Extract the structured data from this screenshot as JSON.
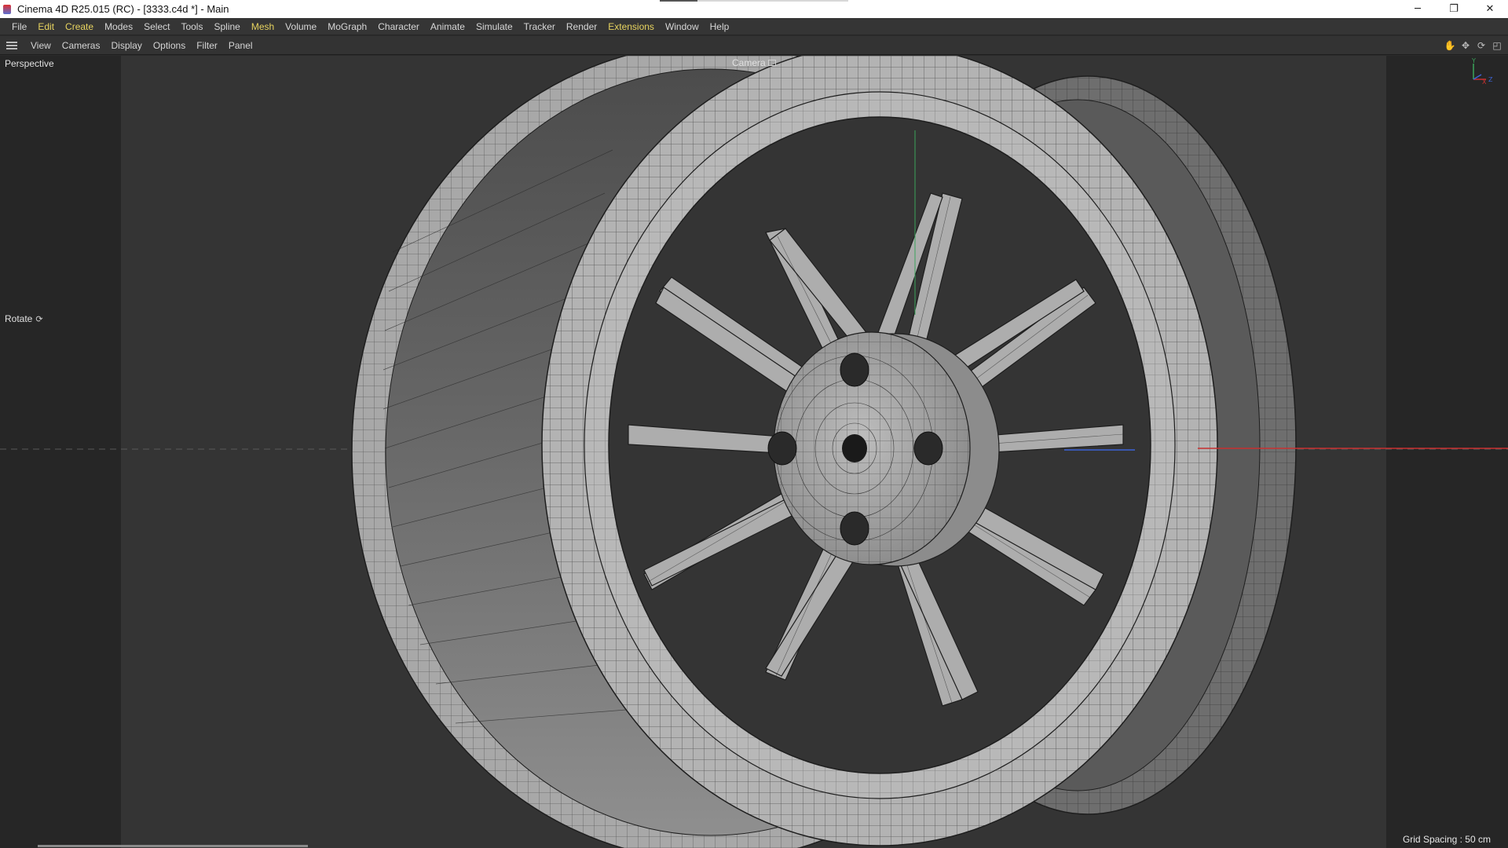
{
  "window": {
    "title": "Cinema 4D R25.015 (RC) - [3333.c4d *] - Main",
    "controls": {
      "minimize": "─",
      "restore": "❐",
      "close": "✕"
    }
  },
  "menubar": {
    "items": [
      "File",
      "Edit",
      "Create",
      "Modes",
      "Select",
      "Tools",
      "Spline",
      "Mesh",
      "Volume",
      "MoGraph",
      "Character",
      "Animate",
      "Simulate",
      "Tracker",
      "Render",
      "Extensions",
      "Window",
      "Help"
    ],
    "highlight_color": "#e7d35f"
  },
  "viewbar": {
    "items": [
      "View",
      "Cameras",
      "Display",
      "Options",
      "Filter",
      "Panel"
    ],
    "nav_icons": [
      "hand-move-icon",
      "arrow-move-icon",
      "rotate-view-icon",
      "maximize-view-icon"
    ]
  },
  "viewport": {
    "projection": "Perspective",
    "tool": "Rotate",
    "camera": "Camera",
    "grid_spacing": "Grid Spacing : 50 cm",
    "axis_labels": {
      "y": "Y",
      "x": "X",
      "z": "Z"
    }
  },
  "colors": {
    "viewport_bg": "#343434",
    "safe_frame": "#262626",
    "mesh_light": "#b9b9b9",
    "mesh_dark": "#555555",
    "wire": "#1e1e1e",
    "axis_x": "#c83030",
    "axis_y": "#3aa35a",
    "axis_z": "#3d63d6"
  }
}
